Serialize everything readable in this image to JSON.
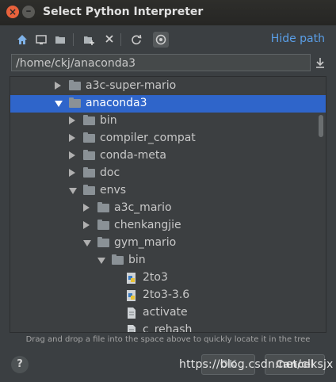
{
  "window": {
    "title": "Select Python Interpreter"
  },
  "toolbar": {
    "icons": [
      "home-icon",
      "desktop-icon",
      "project-folder-icon",
      "new-folder-icon",
      "delete-icon",
      "refresh-icon",
      "show-hidden-icon"
    ],
    "hide_path_label": "Hide path"
  },
  "path": {
    "value": "/home/ckj/anaconda3"
  },
  "tree": {
    "rows": [
      {
        "label": "a3c-super-mario",
        "depth": 0,
        "type": "folder",
        "expanded": false,
        "selected": false
      },
      {
        "label": "anaconda3",
        "depth": 0,
        "type": "folder",
        "expanded": true,
        "selected": true
      },
      {
        "label": "bin",
        "depth": 1,
        "type": "folder",
        "expanded": false,
        "selected": false
      },
      {
        "label": "compiler_compat",
        "depth": 1,
        "type": "folder",
        "expanded": false,
        "selected": false
      },
      {
        "label": "conda-meta",
        "depth": 1,
        "type": "folder",
        "expanded": false,
        "selected": false
      },
      {
        "label": "doc",
        "depth": 1,
        "type": "folder",
        "expanded": false,
        "selected": false
      },
      {
        "label": "envs",
        "depth": 1,
        "type": "folder",
        "expanded": true,
        "selected": false
      },
      {
        "label": "a3c_mario",
        "depth": 2,
        "type": "folder",
        "expanded": false,
        "selected": false
      },
      {
        "label": "chenkangjie",
        "depth": 2,
        "type": "folder",
        "expanded": false,
        "selected": false
      },
      {
        "label": "gym_mario",
        "depth": 2,
        "type": "folder",
        "expanded": true,
        "selected": false
      },
      {
        "label": "bin",
        "depth": 3,
        "type": "folder",
        "expanded": true,
        "selected": false
      },
      {
        "label": "2to3",
        "depth": 4,
        "type": "python-file",
        "selected": false
      },
      {
        "label": "2to3-3.6",
        "depth": 4,
        "type": "python-file",
        "selected": false
      },
      {
        "label": "activate",
        "depth": 4,
        "type": "file",
        "selected": false
      },
      {
        "label": "c_rehash",
        "depth": 4,
        "type": "file",
        "selected": false
      }
    ]
  },
  "hint": "Drag and drop a file into the space above to quickly locate it in the tree",
  "buttons": {
    "help": "?",
    "ok": "OK",
    "cancel": "Cancel"
  },
  "watermark": "https://blog.csdn.net/clksjx",
  "colors": {
    "selection": "#2f65ca",
    "link": "#5a9fe8",
    "close": "#e9623c"
  }
}
